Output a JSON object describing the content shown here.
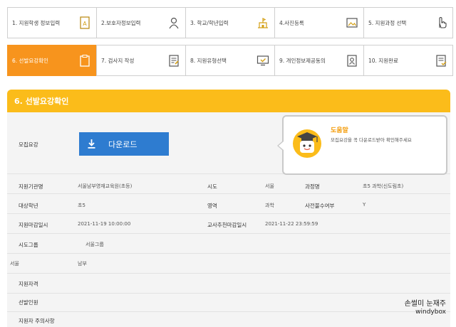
{
  "steps_row1": [
    {
      "label": "1. 지원학생 정보입력",
      "icon": "document-a-icon"
    },
    {
      "label": "2.보호자정보입력",
      "icon": "person-icon"
    },
    {
      "label": "3. 학교/학년입력",
      "icon": "school-icon"
    },
    {
      "label": "4.사진등록",
      "icon": "photo-icon"
    },
    {
      "label": "5. 지원과정 선택",
      "icon": "hand-pointer-icon"
    }
  ],
  "steps_row2": [
    {
      "label": "6. 선발요강확인",
      "icon": "clipboard-icon",
      "active": true
    },
    {
      "label": "7. 검사지 작성",
      "icon": "document-pen-icon"
    },
    {
      "label": "8. 지원유형선택",
      "icon": "monitor-check-icon"
    },
    {
      "label": "9. 개인정보제공동의",
      "icon": "id-card-icon"
    },
    {
      "label": "10. 지원완료",
      "icon": "document-check-icon"
    }
  ],
  "section": {
    "title": "6. 선발요강확인"
  },
  "recruit": {
    "label": "모집요강",
    "download_label": "다운로드"
  },
  "help": {
    "title": "도움말",
    "text": "모집요강을 꼭 다운로드받아 확인해주세요"
  },
  "info": {
    "institution_label": "지원기관명",
    "institution_value": "서울남부영재교육원(초등)",
    "city_label": "시도",
    "city_value": "서울",
    "course_label": "과정명",
    "course_value": "초5 과학(신도림초)",
    "grade_label": "대상학년",
    "grade_value": "초5",
    "field_label": "영역",
    "field_value": "과학",
    "recommend_label": "사전불수여부",
    "recommend_value": "Y",
    "deadline_label": "지원마감일시",
    "deadline_value": "2021-11-19 10:00:00",
    "teacher_deadline_label": "교사추천마감일시",
    "teacher_deadline_value": "2021-11-22 23:59:59",
    "region_group_label": "시도그룹",
    "region_group_value": "서울그룹",
    "region_left": "서울",
    "region_right": "남부",
    "notes_label": "지원자격",
    "selection_label": "선발인원",
    "caution_label": "지원자 주의사항"
  },
  "watermark": {
    "name": "손썰미 눈재주",
    "site": "windybox"
  },
  "colors": {
    "active_step": "#f7941d",
    "header": "#fbbc1a",
    "download": "#2e7cd0",
    "help_title": "#f39800"
  }
}
